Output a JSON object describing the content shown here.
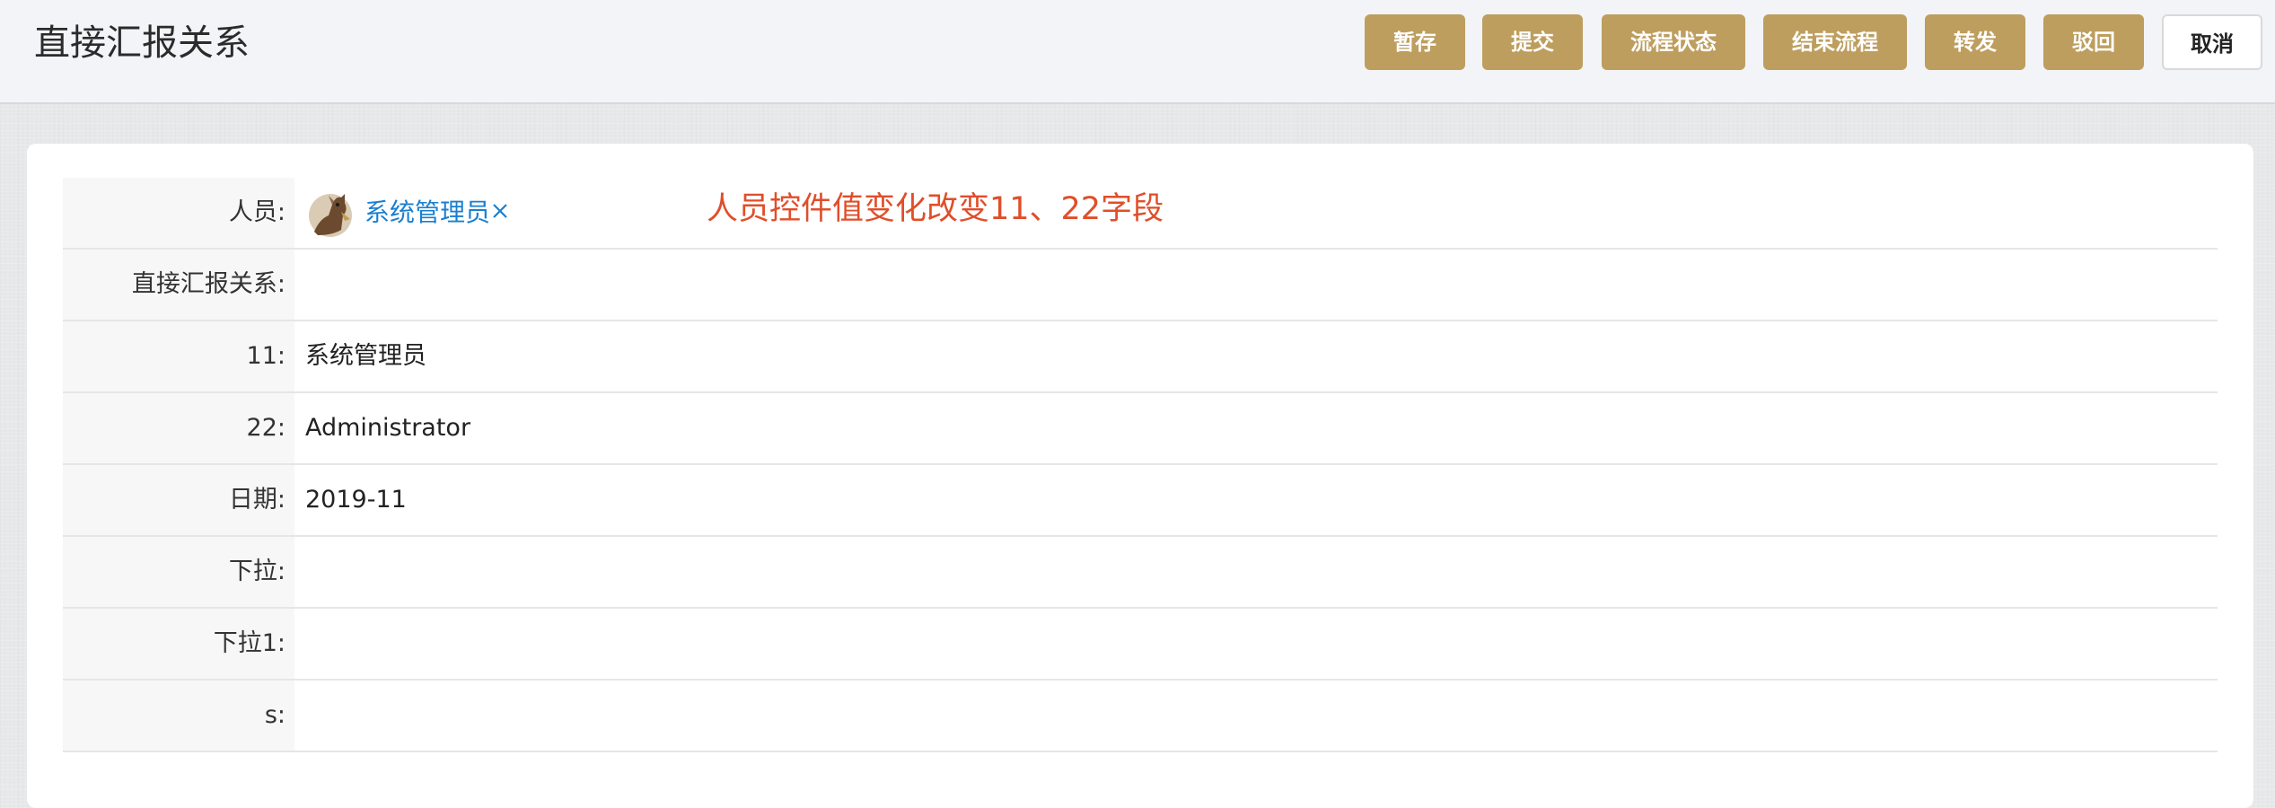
{
  "header": {
    "title": "直接汇报关系",
    "buttons": {
      "save_draft": "暂存",
      "submit": "提交",
      "flow_status": "流程状态",
      "end_flow": "结束流程",
      "forward": "转发",
      "reject": "驳回",
      "cancel": "取消"
    }
  },
  "form": {
    "rows": [
      {
        "label": "人员:",
        "value": "系统管理员"
      },
      {
        "label": "直接汇报关系:",
        "value": ""
      },
      {
        "label": "11:",
        "value": "系统管理员"
      },
      {
        "label": "22:",
        "value": "Administrator"
      },
      {
        "label": "日期:",
        "value": "2019-11"
      },
      {
        "label": "下拉:",
        "value": ""
      },
      {
        "label": "下拉1:",
        "value": ""
      },
      {
        "label": "s:",
        "value": ""
      }
    ],
    "annotation": "人员控件值变化改变11、22字段"
  },
  "colors": {
    "accent_button": "#bd9e5e",
    "link": "#1a7fd0",
    "annotation": "#e04e2a"
  },
  "icons": {
    "avatar": "user-avatar",
    "remove": "close-icon"
  }
}
